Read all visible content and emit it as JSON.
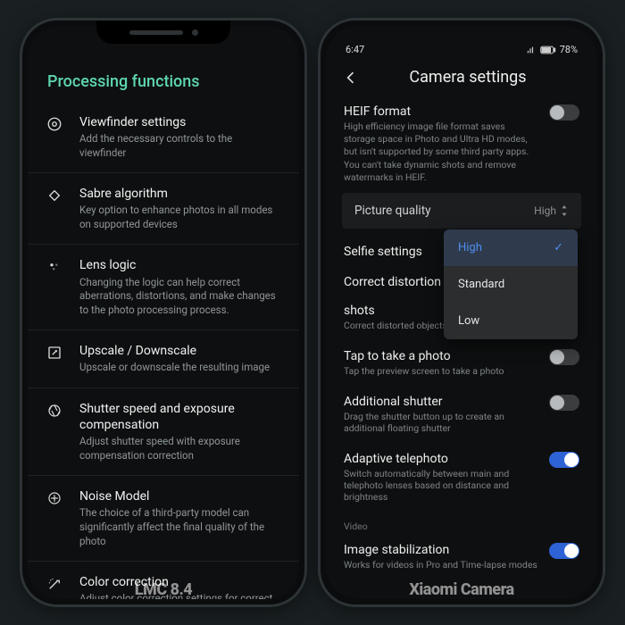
{
  "left": {
    "page_title": "Processing functions",
    "items": [
      {
        "title": "Viewfinder settings",
        "sub": "Add the necessary controls to the viewfinder",
        "icon": "viewfinder"
      },
      {
        "title": "Sabre algorithm",
        "sub": "Key option to enhance photos in all modes on supported devices",
        "icon": "diamond"
      },
      {
        "title": "Lens logic",
        "sub": "Changing the logic can help correct aberrations, distortions, and make changes to the photo processing process.",
        "icon": "lens"
      },
      {
        "title": "Upscale / Downscale",
        "sub": "Upscale or downscale the resulting image",
        "icon": "scale"
      },
      {
        "title": "Shutter speed and exposure compensation",
        "sub": "Adjust shutter speed with exposure compensation correction",
        "icon": "shutter"
      },
      {
        "title": "Noise Model",
        "sub": "The choice of a third-party model can significantly affect the final quality of the photo",
        "icon": "noise"
      },
      {
        "title": "Color correction",
        "sub": "Adjust color correction settings for correct color reproduction",
        "icon": "color"
      }
    ],
    "watermark": "LMC 8.4"
  },
  "right": {
    "status": {
      "time": "6:47",
      "battery": "78%"
    },
    "header": "Camera settings",
    "heif": {
      "title": "HEIF format",
      "sub": "High efficiency image file format saves storage space in Photo and Ultra HD modes, but isn't supported by some third party apps. You can't take dynamic shots and remove watermarks in HEIF.",
      "on": false
    },
    "picture_quality": {
      "label": "Picture quality",
      "value": "High"
    },
    "selfie": "Selfie settings",
    "dropdown": {
      "options": [
        "High",
        "Standard",
        "Low"
      ],
      "selected": "High"
    },
    "distortion": {
      "title": "Correct distortion in group selfies and wide-angle shots",
      "sub": "Correct distorted objects"
    },
    "tap": {
      "title": "Tap to take a photo",
      "sub": "Tap the preview screen to take a photo",
      "on": false
    },
    "shutter2": {
      "title": "Additional shutter",
      "sub": "Drag the shutter button up to create an additional floating shutter",
      "on": false
    },
    "tele": {
      "title": "Adaptive telephoto",
      "sub": "Switch automatically between main and telephoto lenses based on distance and brightness",
      "on": true
    },
    "video_cat": "Video",
    "stab": {
      "title": "Image stabilization",
      "sub": "Works for videos in Pro and Time-lapse modes",
      "on": true
    },
    "watermark": "Xiaomi Camera"
  }
}
